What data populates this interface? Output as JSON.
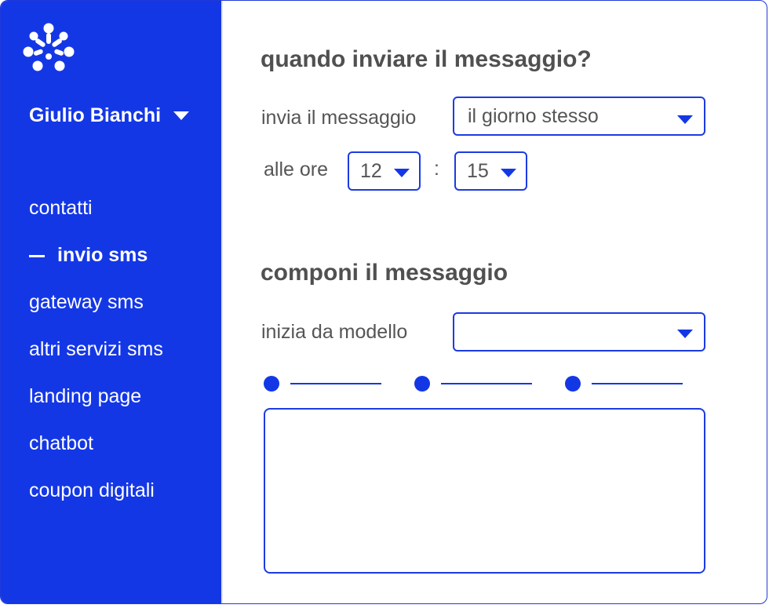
{
  "colors": {
    "accent": "#1437e6",
    "text": "#555555",
    "heading": "#505050"
  },
  "sidebar": {
    "logo_icon": "flower-logo-icon",
    "user_name": "Giulio Bianchi",
    "user_menu_icon": "caret-down-icon",
    "items": [
      {
        "label": "contatti",
        "active": false
      },
      {
        "label": "invio sms",
        "active": true
      },
      {
        "label": "gateway sms",
        "active": false
      },
      {
        "label": "altri servizi sms",
        "active": false
      },
      {
        "label": "landing page",
        "active": false
      },
      {
        "label": "chatbot",
        "active": false
      },
      {
        "label": "coupon digitali",
        "active": false
      }
    ]
  },
  "schedule": {
    "title": "quando inviare il messaggio?",
    "send_label": "invia il messaggio",
    "send_value": "il giorno stesso",
    "time_label": "alle ore",
    "hour_value": "12",
    "separator": ":",
    "minute_value": "15"
  },
  "compose": {
    "title": "componi il messaggio",
    "template_label": "inizia da modello",
    "template_value": "",
    "message_value": ""
  }
}
